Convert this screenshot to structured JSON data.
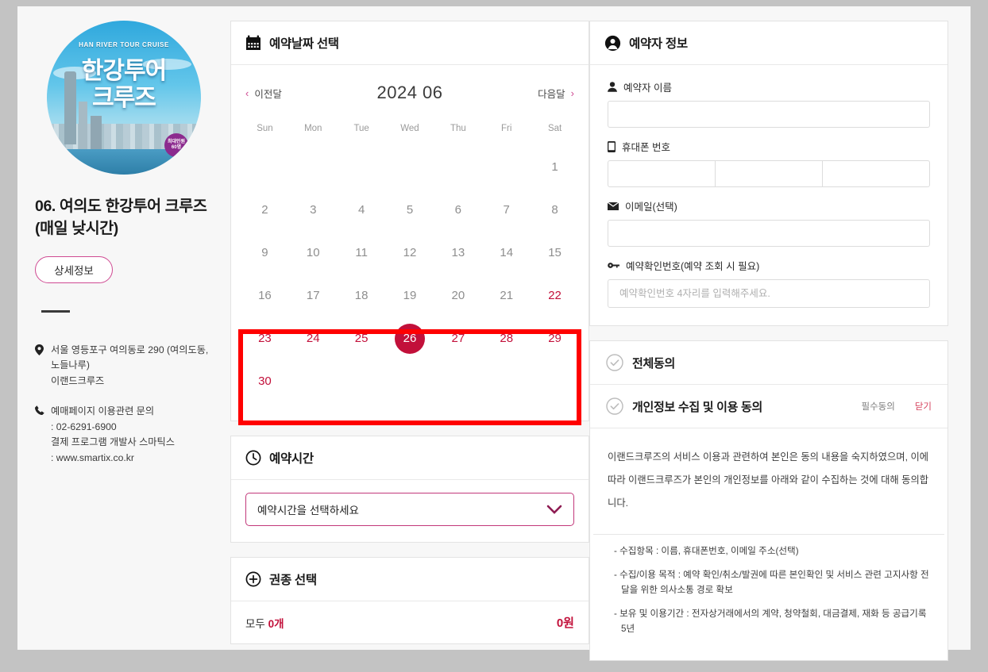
{
  "product": {
    "image_eng_text": "HAN RIVER TOUR CRUISE",
    "image_kr_line1": "한강투어",
    "image_kr_line2": "크루즈",
    "image_badge_line1": "최대인원",
    "image_badge_line2": "60명",
    "title": "06. 여의도 한강투어 크루즈 (매일 낮시간)",
    "detail_button": "상세정보",
    "address_line1": "서울 영등포구 여의동로 290 (여의도동, 노들나루)",
    "address_line2": "이랜드크루즈",
    "contact_line1": "예매페이지 이용관련 문의",
    "contact_line2": ": 02-6291-6900",
    "contact_line3": "결제 프로그램 개발사 스마틱스",
    "contact_line4": ": www.smartix.co.kr"
  },
  "calendar": {
    "header": "예약날짜 선택",
    "prev_label": "이전달",
    "next_label": "다음달",
    "month_title": "2024 06",
    "weekdays": [
      "Sun",
      "Mon",
      "Tue",
      "Wed",
      "Thu",
      "Fri",
      "Sat"
    ],
    "leading_blanks": 6,
    "days": [
      {
        "n": "1",
        "state": "disabled"
      },
      {
        "n": "2",
        "state": "disabled"
      },
      {
        "n": "3",
        "state": "disabled"
      },
      {
        "n": "4",
        "state": "disabled"
      },
      {
        "n": "5",
        "state": "disabled"
      },
      {
        "n": "6",
        "state": "disabled"
      },
      {
        "n": "7",
        "state": "disabled"
      },
      {
        "n": "8",
        "state": "disabled"
      },
      {
        "n": "9",
        "state": "disabled"
      },
      {
        "n": "10",
        "state": "disabled"
      },
      {
        "n": "11",
        "state": "disabled"
      },
      {
        "n": "12",
        "state": "disabled"
      },
      {
        "n": "13",
        "state": "disabled"
      },
      {
        "n": "14",
        "state": "disabled"
      },
      {
        "n": "15",
        "state": "disabled"
      },
      {
        "n": "16",
        "state": "disabled"
      },
      {
        "n": "17",
        "state": "disabled"
      },
      {
        "n": "18",
        "state": "disabled"
      },
      {
        "n": "19",
        "state": "disabled"
      },
      {
        "n": "20",
        "state": "disabled"
      },
      {
        "n": "21",
        "state": "disabled"
      },
      {
        "n": "22",
        "state": "enabled"
      },
      {
        "n": "23",
        "state": "enabled"
      },
      {
        "n": "24",
        "state": "enabled"
      },
      {
        "n": "25",
        "state": "enabled"
      },
      {
        "n": "26",
        "state": "selected"
      },
      {
        "n": "27",
        "state": "enabled"
      },
      {
        "n": "28",
        "state": "enabled"
      },
      {
        "n": "29",
        "state": "enabled"
      },
      {
        "n": "30",
        "state": "enabled"
      }
    ],
    "selected_day": "26",
    "highlight_color": "#ff0000",
    "accent_color": "#c2103a"
  },
  "time_section": {
    "header": "예약시간",
    "select_value": "예약시간을 선택하세요",
    "border_color": "#c2387a"
  },
  "ticket_section": {
    "header": "권종 선택",
    "total_label": "모두",
    "total_count": "0개",
    "total_price": "0원"
  },
  "booker": {
    "header": "예약자 정보",
    "name_label": "예약자 이름",
    "name_value": "",
    "phone_label": "휴대폰 번호",
    "phone_part1": "",
    "phone_part2": "",
    "phone_part3": "",
    "email_label": "이메일(선택)",
    "email_value": "",
    "confirm_label": "예약확인번호(예약 조회 시 필요)",
    "confirm_placeholder": "예약확인번호 4자리를 입력해주세요.",
    "confirm_value": ""
  },
  "agreements": {
    "all_agree_label": "전체동의",
    "privacy_label": "개인정보 수집 및 이용 동의",
    "required_badge": "필수동의",
    "close_label": "닫기",
    "policy_paragraph": "이랜드크루즈의 서비스 이용과 관련하여 본인은 동의 내용을 숙지하였으며, 이에 따라 이랜드크루즈가 본인의 개인정보를 아래와 같이 수집하는 것에 대해 동의합니다.",
    "policy_items": [
      "- 수집항목 : 이름, 휴대폰번호, 이메일 주소(선택)",
      "- 수집/이용 목적 : 예약 확인/취소/발권에 따른 본인확인 및 서비스 관련 고지사항 전달을 위한 의사소통 경로 확보",
      "- 보유 및 이용기간 : 전자상거래에서의 계약, 청약철회, 대금결제, 재화 등 공급기록 5년"
    ]
  }
}
